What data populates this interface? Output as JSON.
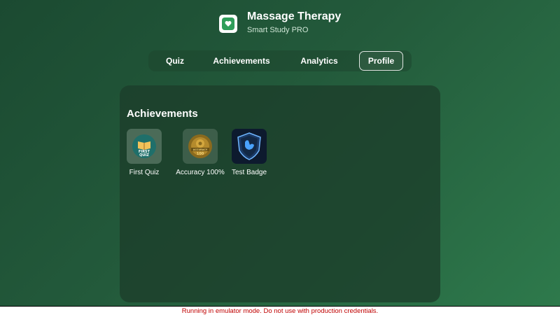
{
  "header": {
    "title": "Massage Therapy",
    "subtitle": "Smart Study PRO",
    "logo_icon": "heart-hands-icon"
  },
  "tabs": [
    {
      "label": "Quiz",
      "active": false
    },
    {
      "label": "Achievements",
      "active": false
    },
    {
      "label": "Analytics",
      "active": false
    },
    {
      "label": "Profile",
      "active": true
    }
  ],
  "achievements": {
    "title": "Achievements",
    "badges": [
      {
        "label": "First Quiz",
        "icon": "open-book-icon",
        "icon_text": [
          "FIRST",
          "QUIZ"
        ]
      },
      {
        "label": "Accuracy 100%",
        "icon": "target-medal-icon",
        "icon_text": [
          "ACCURACY",
          "100"
        ]
      },
      {
        "label": "Test Badge",
        "icon": "shield-icon"
      }
    ]
  },
  "status": {
    "message": "Running in emulator mode. Do not use with production credentials."
  },
  "colors": {
    "background_start": "#1b4a31",
    "background_end": "#2e7a4c",
    "panel": "#1c3e2a",
    "status_text": "#c00000"
  }
}
